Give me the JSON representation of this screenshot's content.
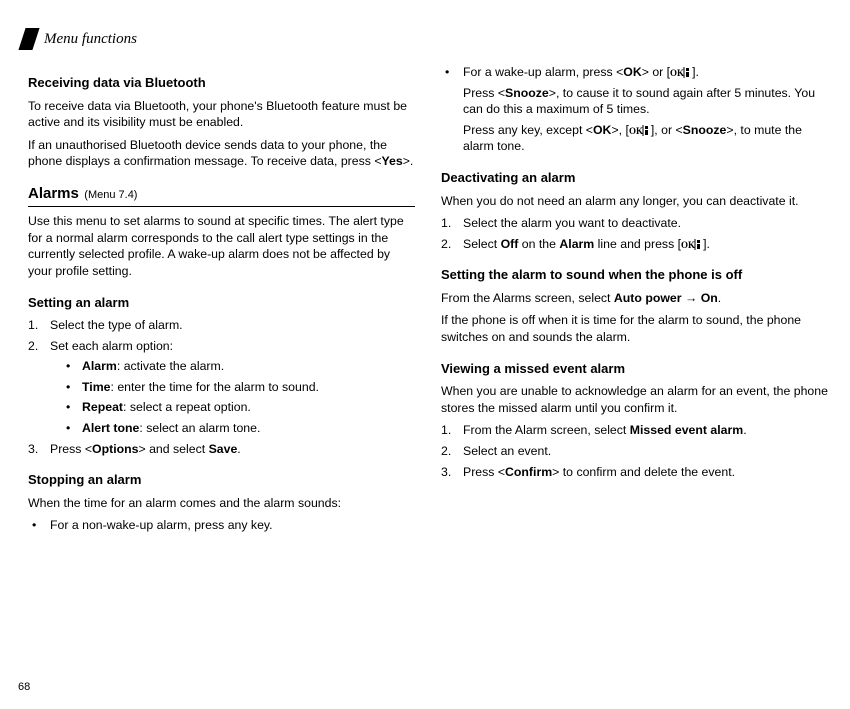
{
  "header": {
    "title": "Menu functions"
  },
  "page_number": "68",
  "left": {
    "h1": "Receiving data via Bluetooth",
    "p1": "To receive data via Bluetooth, your phone's Bluetooth feature must be active and its visibility must be enabled.",
    "p2a": "If an unauthorised Bluetooth device sends data to your phone, the phone displays a confirmation message. To receive data, press <",
    "p2b_bold": "Yes",
    "p2c": ">.",
    "menu_name": "Alarms",
    "menu_num": "(Menu 7.4)",
    "p3": "Use this menu to set alarms to sound at specific times. The alert type for a normal alarm corresponds to the call alert type settings in the currently selected profile. A wake-up alarm does not be affected by your profile setting.",
    "h2": "Setting an alarm",
    "step1": "Select the type of alarm.",
    "step2": "Set each alarm option:",
    "opt_alarm_b": "Alarm",
    "opt_alarm_t": ": activate the alarm.",
    "opt_time_b": "Time",
    "opt_time_t": ": enter the time for the alarm to sound.",
    "opt_repeat_b": "Repeat",
    "opt_repeat_t": ": select a repeat option.",
    "opt_tone_b": "Alert tone",
    "opt_tone_t": ": select an alarm tone.",
    "step3a": "Press <",
    "step3b_bold": "Options",
    "step3c": "> and select ",
    "step3d_bold": "Save",
    "step3e": ".",
    "h3": "Stopping an alarm",
    "p4": "When the time for an alarm comes and the alarm sounds:",
    "b1": "For a non-wake-up alarm, press any key."
  },
  "right": {
    "b1a": "For a wake-up alarm, press <",
    "b1b_bold": "OK",
    "b1c": "> or [",
    "b1d": "].",
    "b1_p2a": "Press <",
    "b1_p2b_bold": "Snooze",
    "b1_p2c": ">, to cause it to sound again after 5 minutes. You can do this a maximum of 5 times.",
    "b1_p3a": "Press any key, except <",
    "b1_p3b_bold": "OK",
    "b1_p3c": ">, [",
    "b1_p3d": "], or <",
    "b1_p3e_bold": "Snooze",
    "b1_p3f": ">, to mute the alarm tone.",
    "h1": "Deactivating an alarm",
    "p1": "When you do not need an alarm any longer, you can deactivate it.",
    "s1": "Select the alarm you want to deactivate.",
    "s2a": "Select ",
    "s2b_bold": "Off",
    "s2c": " on the ",
    "s2d_bold": "Alarm",
    "s2e": " line and press [",
    "s2f": "].",
    "h2": "Setting the alarm to sound when the phone is off",
    "p2a": "From the Alarms screen, select ",
    "p2b_bold": "Auto power",
    "p2c": " → ",
    "p2d_bold": "On",
    "p2e": ".",
    "p3": "If the phone is off when it is time for the alarm to sound, the phone switches on and sounds the alarm.",
    "h3": "Viewing a missed event alarm",
    "p4": "When you are unable to acknowledge an alarm for an event, the phone stores the missed alarm until you confirm it.",
    "m1a": "From the Alarm screen, select ",
    "m1b_bold": "Missed event alarm",
    "m1c": ".",
    "m2": "Select an event.",
    "m3a": "Press <",
    "m3b_bold": "Confirm",
    "m3c": "> to confirm and delete the event."
  }
}
